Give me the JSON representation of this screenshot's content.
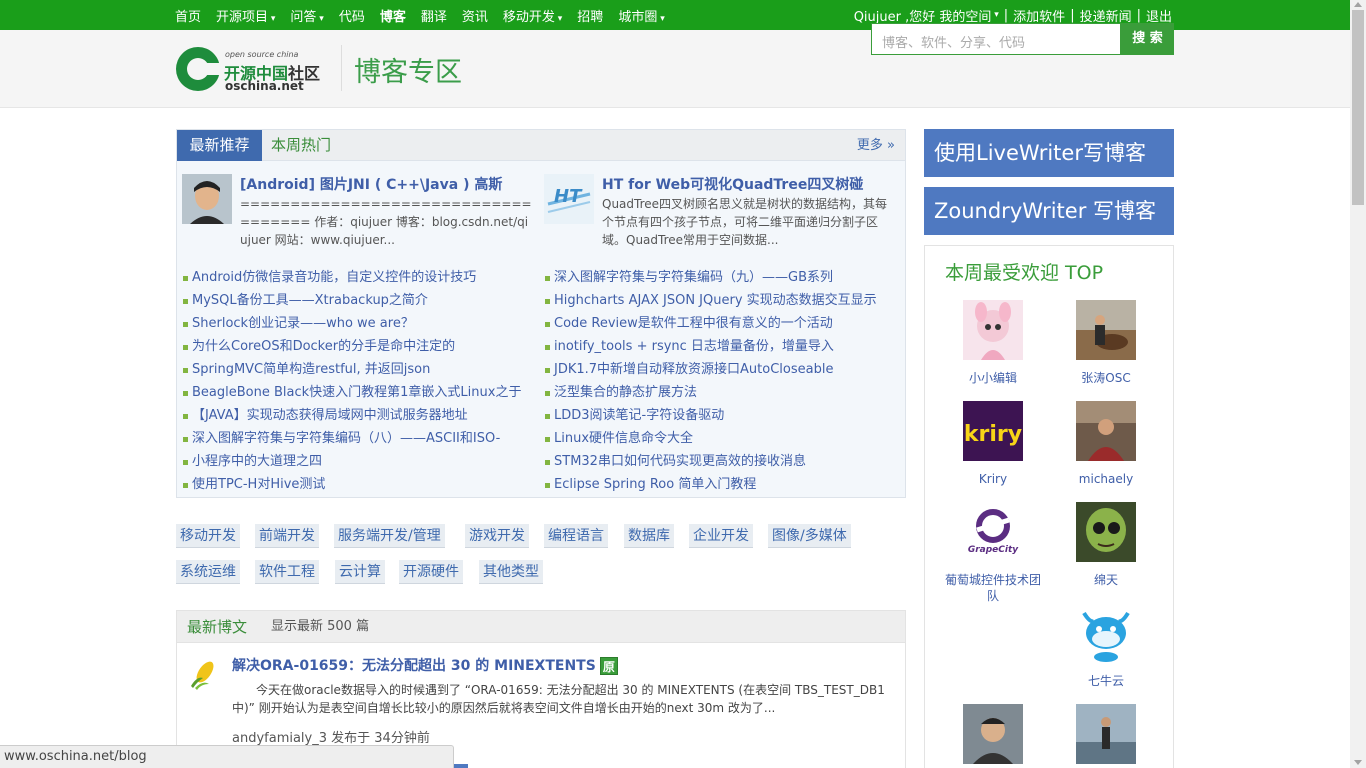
{
  "topnav": {
    "items": [
      {
        "label": "首页",
        "dropdown": false
      },
      {
        "label": "开源项目",
        "dropdown": true
      },
      {
        "label": "问答",
        "dropdown": true
      },
      {
        "label": "代码",
        "dropdown": false
      },
      {
        "label": "博客",
        "dropdown": false
      },
      {
        "label": "翻译",
        "dropdown": false
      },
      {
        "label": "资讯",
        "dropdown": false
      },
      {
        "label": "移动开发",
        "dropdown": true
      },
      {
        "label": "招聘",
        "dropdown": false
      },
      {
        "label": "城市圈",
        "dropdown": true
      }
    ],
    "user_greeting": "Qiujuer ,您好",
    "my_space": "我的空间",
    "add_software": "添加软件",
    "submit_news": "投递新闻",
    "logout": "退出"
  },
  "header": {
    "logo_small": "open source china",
    "logo_name_a": "开源中国",
    "logo_name_b": "社区",
    "logo_domain": "oschina.net",
    "section_title": "博客专区",
    "search_placeholder": "博客、软件、分享、代码",
    "search_button": "搜 索"
  },
  "recommend": {
    "tab_latest": "最新推荐",
    "tab_hot": "本周热门",
    "more": "更多 »",
    "featured": [
      {
        "title": "[Android] 图片JNI ( C++\\Java ) 高斯",
        "desc": "==================================== 作者：qiujuer 博客：blog.csdn.net/qiujuer 网站：www.qiujuer..."
      },
      {
        "title": "HT for Web可视化QuadTree四叉树碰",
        "desc": "QuadTree四叉树顾名思义就是树状的数据结构，其每个节点有四个孩子节点，可将二维平面递归分割子区域。QuadTree常用于空间数据..."
      }
    ],
    "left_list": [
      "Android仿微信录音功能，自定义控件的设计技巧",
      "MySQL备份工具——Xtrabackup之简介",
      "Sherlock创业记录——who we are？",
      "为什么CoreOS和Docker的分手是命中注定的",
      "SpringMVC简单构造restful, 并返回json",
      "BeagleBone Black快速入门教程第1章嵌入式Linux之于",
      "【JAVA】实现动态获得局域网中测试服务器地址",
      "深入图解字符集与字符集编码（八）——ASCII和ISO-",
      "小程序中的大道理之四",
      "使用TPC-H对Hive测试"
    ],
    "right_list": [
      "深入图解字符集与字符集编码（九）——GB系列",
      "Highcharts AJAX JSON JQuery 实现动态数据交互显示",
      "Code Review是软件工程中很有意义的一个活动",
      "inotify_tools + rsync 日志增量备份，增量导入",
      "JDK1.7中新增自动释放资源接口AutoCloseable",
      "泛型集合的静态扩展方法",
      "LDD3阅读笔记-字符设备驱动",
      "Linux硬件信息命令大全",
      "STM32串口如何代码实现更高效的接收消息",
      "Eclipse Spring Roo 简单入门教程"
    ]
  },
  "categories": [
    "移动开发",
    "前端开发",
    "服务端开发/管理",
    "游戏开发",
    "编程语言",
    "数据库",
    "企业开发",
    "图像/多媒体",
    "系统运维",
    "软件工程",
    "云计算",
    "开源硬件",
    "其他类型"
  ],
  "latest": {
    "title": "最新博文",
    "subtitle": "显示最新 500 篇",
    "post": {
      "title": "解决ORA-01659：无法分配超出 30 的 MINEXTENTS",
      "badge": "原",
      "summary": "今天在做oracle数据导入的时候遇到了 “ORA-01659: 无法分配超出 30 的 MINEXTENTS (在表空间 TBS_TEST_DB1 中)” 刚开始认为是表空间自增长比较小的原因然后就将表空间文件自增长由开始的next 30m 改为了...",
      "meta": "andyfamialy_3 发布于 34分钟前"
    }
  },
  "sidebar": {
    "livewriter": "使用LiveWriter写博客",
    "zoundry": "ZoundryWriter 写博客",
    "top_title": "本周最受欢迎 TOP",
    "users": [
      "小小编辑",
      "张涛OSC",
      "Kriry",
      "michaely",
      "葡萄城控件技术团队",
      "绵天",
      "七牛云"
    ],
    "kriry_logo_text": "kriry",
    "grapecity_logo_text": "GrapeCity"
  },
  "statusbar": {
    "url": "www.oschina.net/blog"
  }
}
